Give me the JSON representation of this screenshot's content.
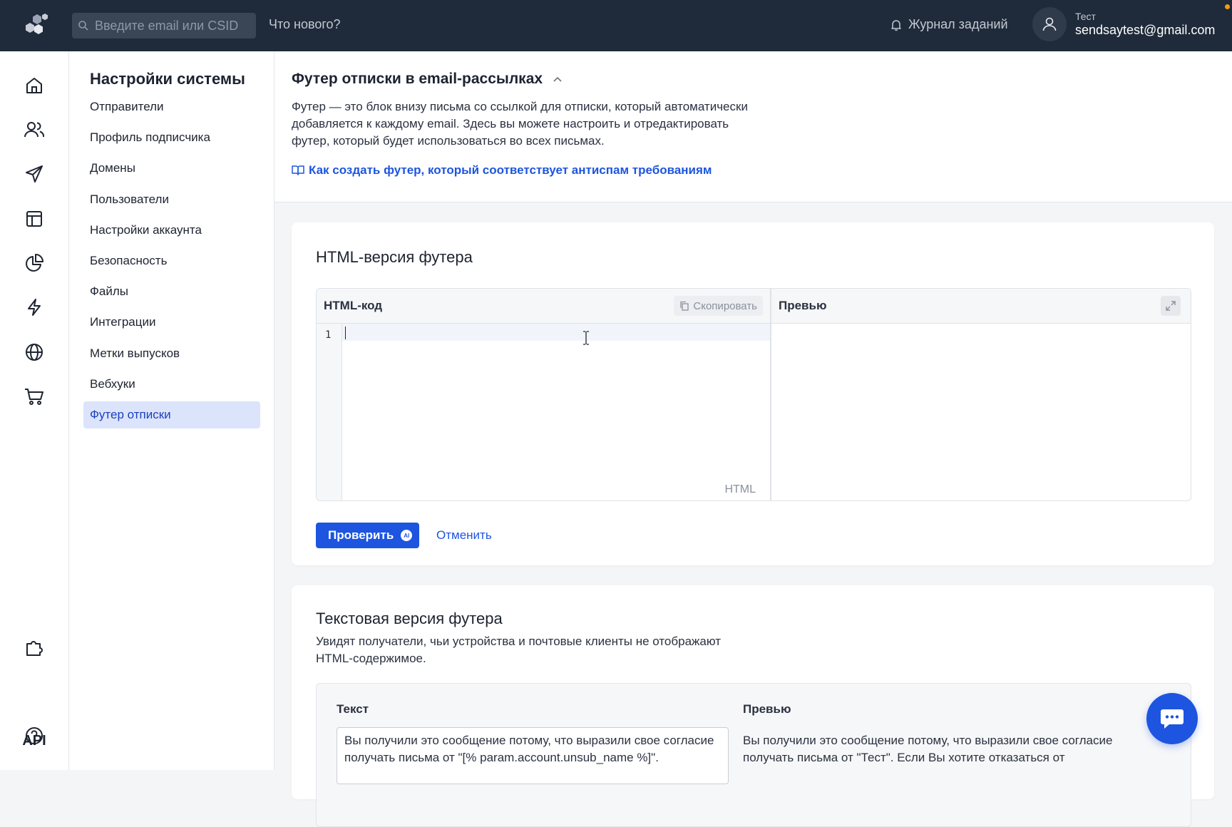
{
  "topbar": {
    "search_placeholder": "Введите email или CSID",
    "whats_new": "Что нового?",
    "jobs_log": "Журнал заданий",
    "user_name": "Тест",
    "user_email": "sendsaytest@gmail.com"
  },
  "rail": {
    "icons": [
      "home-icon",
      "users-icon",
      "send-icon",
      "layout-icon",
      "chart-pie-icon",
      "lightning-icon",
      "globe-icon",
      "cart-icon",
      "puzzle-icon",
      "help-icon"
    ],
    "api_label": "API"
  },
  "settings_nav": {
    "title": "Настройки системы",
    "items": [
      {
        "label": "Отправители"
      },
      {
        "label": "Профиль подписчика"
      },
      {
        "label": "Домены"
      },
      {
        "label": "Пользователи"
      },
      {
        "label": "Настройки аккаунта"
      },
      {
        "label": "Безопасность"
      },
      {
        "label": "Файлы"
      },
      {
        "label": "Интеграции"
      },
      {
        "label": "Метки выпусков"
      },
      {
        "label": "Вебхуки"
      },
      {
        "label": "Футер отписки"
      }
    ],
    "active_index": 10
  },
  "page": {
    "title": "Футер отписки в email-рассылках",
    "description": "Футер — это блок внизу письма со ссылкой для отписки, который автоматически добавляется к каждому email. Здесь вы можете настроить и отредактировать футер, который будет использоваться во всех письмах.",
    "help_link": "Как создать футер, который соответствует антиспам требованиям"
  },
  "html_card": {
    "title": "HTML-версия футера",
    "code_label": "HTML-код",
    "copy_label": "Скопировать",
    "preview_label": "Превью",
    "line_number": "1",
    "language_label": "HTML",
    "check_button": "Проверить",
    "ai_badge": "AI",
    "cancel_button": "Отменить"
  },
  "text_card": {
    "title": "Текстовая версия футера",
    "description": "Увидят получатели, чьи устройства и почтовые клиенты не отображают HTML-содержимое.",
    "text_label": "Текст",
    "preview_label": "Превью",
    "text_value": "Вы получили это сообщение потому, что выразили свое согласие получать письма от \"[% param.account.unsub_name %]\".",
    "preview_value": "Вы получили это сообщение потому, что выразили свое согласие получать письма от \"Тест\". Если Вы хотите отказаться от"
  },
  "colors": {
    "topbar_bg": "#1f2a3a",
    "accent": "#1d55e0",
    "active_nav_bg": "#dbe4fb"
  }
}
